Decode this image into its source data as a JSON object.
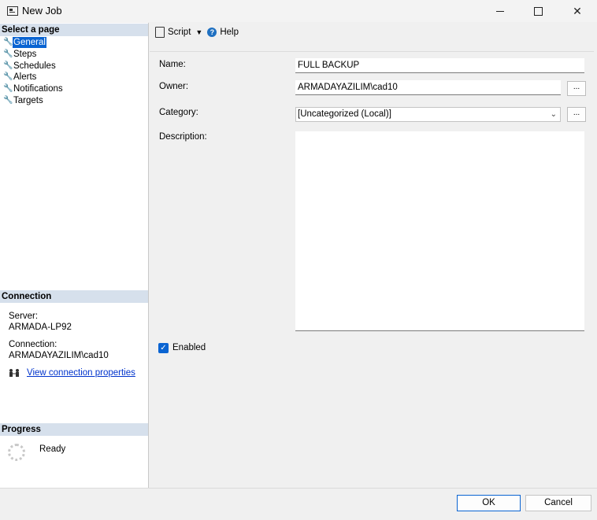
{
  "window": {
    "title": "New Job",
    "minimize_icon": "minimize-icon",
    "maximize_icon": "maximize-icon",
    "close_glyph": "✕"
  },
  "left_pane": {
    "select_page_header": "Select a page",
    "pages": [
      {
        "label": "General",
        "selected": true
      },
      {
        "label": "Steps"
      },
      {
        "label": "Schedules"
      },
      {
        "label": "Alerts"
      },
      {
        "label": "Notifications"
      },
      {
        "label": "Targets"
      }
    ],
    "connection_header": "Connection",
    "server_label": "Server:",
    "server_value": "ARMADA-LP92",
    "connection_label": "Connection:",
    "connection_value": "ARMADAYAZILIM\\cad10",
    "view_connection_link": "View connection properties",
    "progress_header": "Progress",
    "progress_status": "Ready"
  },
  "toolbar": {
    "script_label": "Script",
    "help_label": "Help"
  },
  "form": {
    "name_label": "Name:",
    "name_value": "FULL BACKUP",
    "owner_label": "Owner:",
    "owner_value": "ARMADAYAZILIM\\cad10",
    "category_label": "Category:",
    "category_value": "[Uncategorized (Local)]",
    "description_label": "Description:",
    "description_value": "",
    "enabled_label": "Enabled",
    "enabled_checked": true,
    "browse_label": "..."
  },
  "buttons": {
    "ok": "OK",
    "cancel": "Cancel"
  },
  "colors": {
    "accent": "#0a64d2",
    "section_header_bg": "#d6e0ec",
    "link": "#0033cc"
  }
}
